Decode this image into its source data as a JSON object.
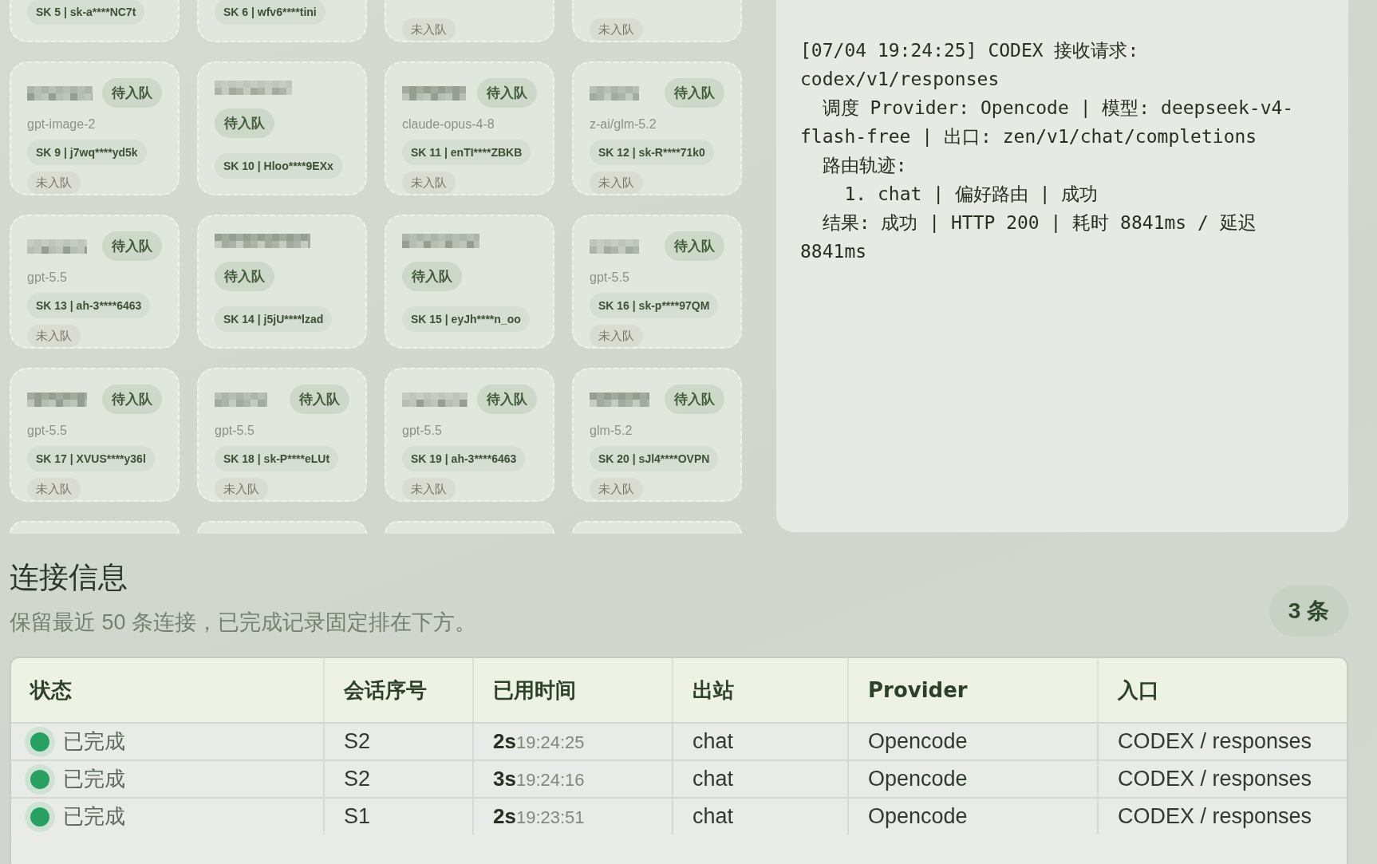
{
  "cards": [
    {
      "kind": "cut-top",
      "key": "SK 5 | sk-a****NC7t"
    },
    {
      "kind": "cut-top",
      "key": "SK 6 | wfv6****tini"
    },
    {
      "kind": "cut-top",
      "queue": "未入队"
    },
    {
      "kind": "cut-top",
      "queue": "未入队"
    },
    {
      "kind": "inline",
      "badge": "待入队",
      "model": "gpt-image-2",
      "key": "SK 9 | j7wq****yd5k",
      "queue": "未入队"
    },
    {
      "kind": "stacked",
      "badge": "待入队",
      "key": "SK 10 | Hloo****9EXx"
    },
    {
      "kind": "inline",
      "badge": "待入队",
      "model": "claude-opus-4-8",
      "key": "SK 11 | enTI****ZBKB",
      "queue": "未入队"
    },
    {
      "kind": "inline",
      "badge": "待入队",
      "model": "z-ai/glm-5.2",
      "key": "SK 12 | sk-R****71k0",
      "queue": "未入队"
    },
    {
      "kind": "inline",
      "badge": "待入队",
      "model": "gpt-5.5",
      "key": "SK 13 | ah-3****6463",
      "queue": "未入队"
    },
    {
      "kind": "stacked",
      "badge": "待入队",
      "key": "SK 14 | j5jU****lzad"
    },
    {
      "kind": "stacked",
      "badge": "待入队",
      "key": "SK 15 | eyJh****n_oo"
    },
    {
      "kind": "inline",
      "badge": "待入队",
      "model": "gpt-5.5",
      "key": "SK 16 | sk-p****97QM",
      "queue": "未入队"
    },
    {
      "kind": "inline",
      "badge": "待入队",
      "model": "gpt-5.5",
      "key": "SK 17 | XVUS****y36l",
      "queue": "未入队"
    },
    {
      "kind": "inline",
      "badge": "待入队",
      "model": "gpt-5.5",
      "key": "SK 18 | sk-P****eLUt",
      "queue": "未入队"
    },
    {
      "kind": "inline",
      "badge": "待入队",
      "model": "gpt-5.5",
      "key": "SK 19 | ah-3****6463",
      "queue": "未入队"
    },
    {
      "kind": "inline",
      "badge": "待入队",
      "model": "glm-5.2",
      "key": "SK 20 | sJl4****OVPN",
      "queue": "未入队"
    },
    {
      "kind": "cut-bottom"
    },
    {
      "kind": "cut-bottom"
    },
    {
      "kind": "cut-bottom"
    },
    {
      "kind": "cut-bottom"
    }
  ],
  "log": {
    "lines": [
      "[07/04 19:24:25] CODEX 接收请求: codex/v1/responses",
      "  调度 Provider: Opencode | 模型: deepseek-v4-flash-free | 出口: zen/v1/chat/completions",
      "  路由轨迹:",
      "    1. chat | 偏好路由 | 成功",
      "  结果: 成功 | HTTP 200 | 耗时 8841ms / 延迟 8841ms"
    ]
  },
  "connections": {
    "title": "连接信息",
    "subtitle": "保留最近 50 条连接，已完成记录固定排在下方。",
    "count": "3 条",
    "columns": [
      "状态",
      "会话序号",
      "已用时间",
      "出站",
      "Provider",
      "入口"
    ],
    "rows": [
      {
        "kind": "done",
        "status": "已完成",
        "session": "S2",
        "elapsed": "2s",
        "started": "19:24:25",
        "outbound": "chat",
        "provider": "Opencode",
        "entry": "CODEX / responses"
      },
      {
        "kind": "done",
        "status": "已完成",
        "session": "S2",
        "elapsed": "3s",
        "started": "19:24:16",
        "outbound": "chat",
        "provider": "Opencode",
        "entry": "CODEX / responses"
      },
      {
        "kind": "done",
        "status": "已完成",
        "session": "S1",
        "elapsed": "2s",
        "started": "19:23:51",
        "outbound": "chat",
        "provider": "Opencode",
        "entry": "CODEX / responses"
      }
    ]
  }
}
